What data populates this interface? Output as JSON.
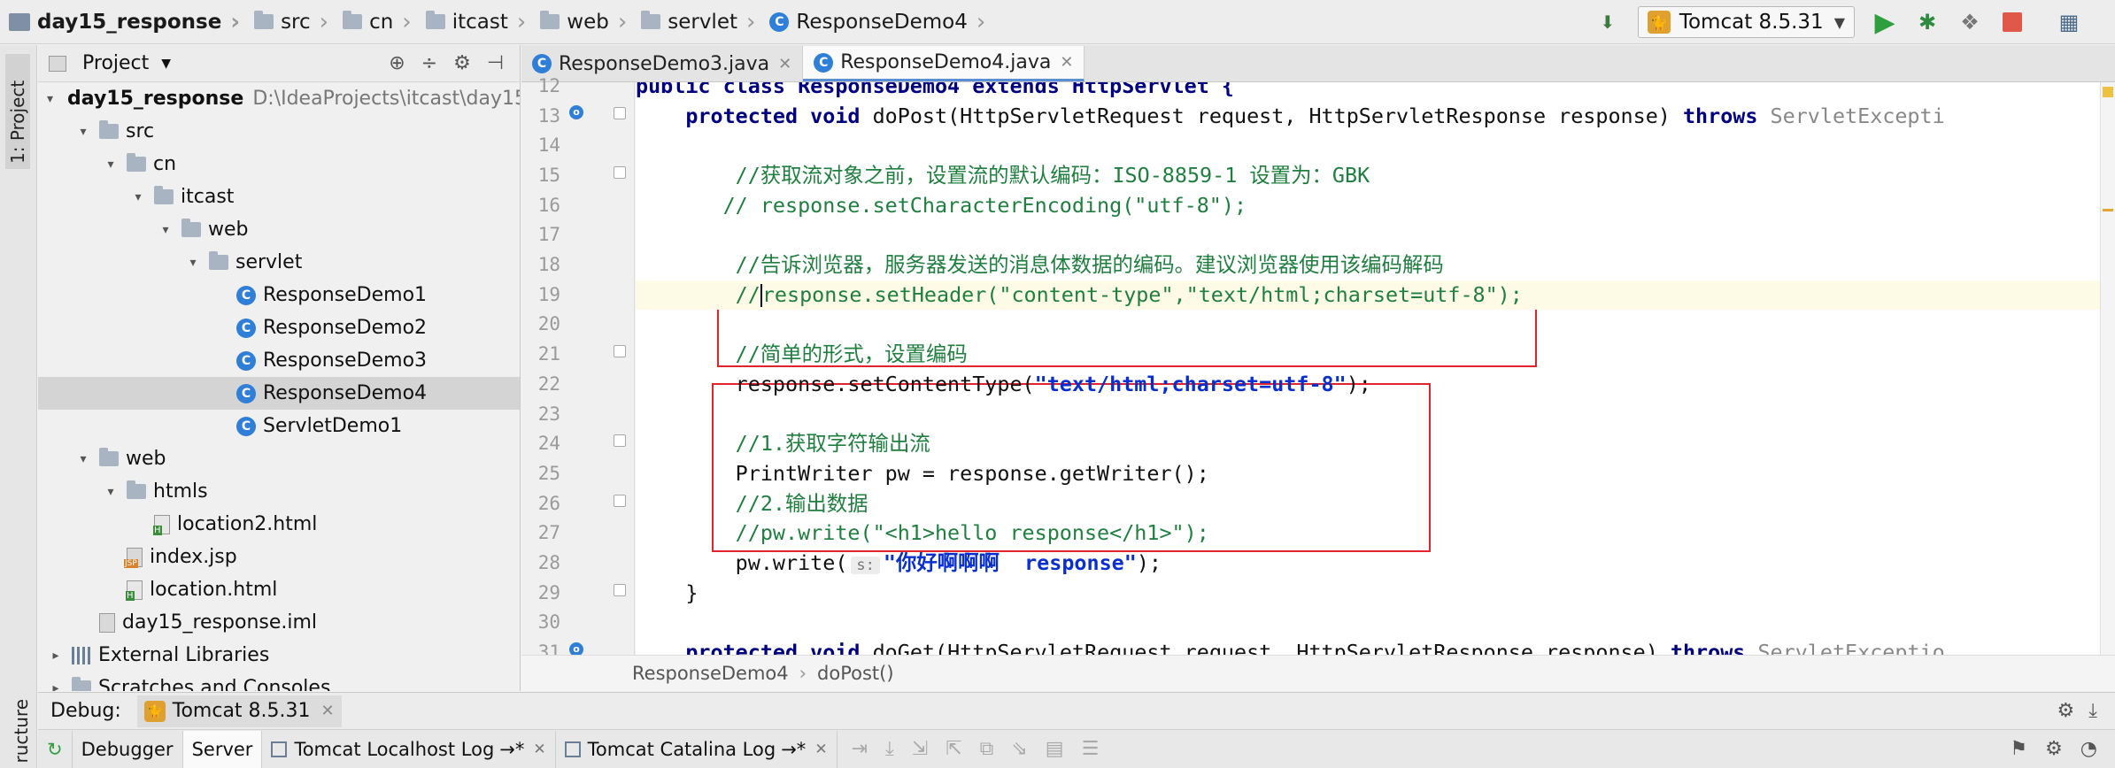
{
  "breadcrumb": [
    {
      "label": "day15_response",
      "icon": "project-module-icon"
    },
    {
      "label": "src",
      "icon": "folder-icon"
    },
    {
      "label": "cn",
      "icon": "folder-icon"
    },
    {
      "label": "itcast",
      "icon": "folder-icon"
    },
    {
      "label": "web",
      "icon": "folder-icon"
    },
    {
      "label": "servlet",
      "icon": "folder-icon"
    },
    {
      "label": "ResponseDemo4",
      "icon": "java-class-icon"
    }
  ],
  "toolbar": {
    "run_config": "Tomcat 8.5.31",
    "accent_run": "#2e9e3e",
    "accent_stop": "#e0584a"
  },
  "side_strip": {
    "project_tab": "1: Project",
    "structure_tab": "ructure"
  },
  "project_panel": {
    "title": "Project",
    "tree": [
      {
        "label": "day15_response",
        "path": "D:\\IdeaProjects\\itcast\\day15",
        "depth": 0,
        "arrow": "▾",
        "icon": "module",
        "bold": true
      },
      {
        "label": "src",
        "depth": 1,
        "arrow": "▾",
        "icon": "folder"
      },
      {
        "label": "cn",
        "depth": 2,
        "arrow": "▾",
        "icon": "folder"
      },
      {
        "label": "itcast",
        "depth": 3,
        "arrow": "▾",
        "icon": "folder"
      },
      {
        "label": "web",
        "depth": 4,
        "arrow": "▾",
        "icon": "folder"
      },
      {
        "label": "servlet",
        "depth": 5,
        "arrow": "▾",
        "icon": "folder"
      },
      {
        "label": "ResponseDemo1",
        "depth": 6,
        "icon": "class"
      },
      {
        "label": "ResponseDemo2",
        "depth": 6,
        "icon": "class"
      },
      {
        "label": "ResponseDemo3",
        "depth": 6,
        "icon": "class"
      },
      {
        "label": "ResponseDemo4",
        "depth": 6,
        "icon": "class",
        "selected": true
      },
      {
        "label": "ServletDemo1",
        "depth": 6,
        "icon": "class"
      },
      {
        "label": "web",
        "depth": 1,
        "arrow": "▾",
        "icon": "folder"
      },
      {
        "label": "htmls",
        "depth": 2,
        "arrow": "▾",
        "icon": "folder"
      },
      {
        "label": "location2.html",
        "depth": 3,
        "icon": "html"
      },
      {
        "label": "index.jsp",
        "depth": 2,
        "icon": "jsp"
      },
      {
        "label": "location.html",
        "depth": 2,
        "icon": "html"
      },
      {
        "label": "day15_response.iml",
        "depth": 1,
        "icon": "file"
      },
      {
        "label": "External Libraries",
        "depth": 0,
        "arrow": "▸",
        "icon": "library"
      },
      {
        "label": "Scratches and Consoles",
        "depth": 0,
        "arrow": "▸",
        "icon": "folder"
      }
    ]
  },
  "editor": {
    "tabs": [
      {
        "label": "ResponseDemo3.java",
        "active": false
      },
      {
        "label": "ResponseDemo4.java",
        "active": true
      }
    ],
    "lines": [
      {
        "n": "12",
        "segments": [
          {
            "t": "public class ResponseDemo4 extends HttpServlet {",
            "c": "kw"
          }
        ]
      },
      {
        "n": "13",
        "segments": [
          {
            "t": "    "
          },
          {
            "t": "protected void ",
            "c": "kw"
          },
          {
            "t": "doPost(HttpServletRequest request, HttpServletResponse response) "
          },
          {
            "t": "throws ",
            "c": "kw"
          },
          {
            "t": "ServletExcepti",
            "c": "gray"
          }
        ]
      },
      {
        "n": "14",
        "segments": []
      },
      {
        "n": "15",
        "segments": [
          {
            "t": "        //获取流对象之前，设置流的默认编码：ISO-8859-1 设置为：GBK",
            "c": "cm"
          }
        ]
      },
      {
        "n": "16",
        "segments": [
          {
            "t": "       // response.setCharacterEncoding(\"utf-8\");",
            "c": "cm"
          }
        ]
      },
      {
        "n": "17",
        "segments": []
      },
      {
        "n": "18",
        "segments": [
          {
            "t": "        //告诉浏览器，服务器发送的消息体数据的编码。建议浏览器使用该编码解码",
            "c": "cm"
          }
        ]
      },
      {
        "n": "19",
        "segments": [
          {
            "t": "        //",
            "c": "cm"
          },
          {
            "t": "|",
            "c": "caret"
          },
          {
            "t": "response.setHeader(\"content-type\",\"text/html;charset=utf-8\");",
            "c": "cm"
          }
        ],
        "current": true
      },
      {
        "n": "20",
        "segments": []
      },
      {
        "n": "21",
        "segments": [
          {
            "t": "        //简单的形式，设置编码",
            "c": "cm"
          }
        ]
      },
      {
        "n": "22",
        "segments": [
          {
            "t": "        response.setContentType("
          },
          {
            "t": "\"text/html;charset=utf-8\"",
            "c": "strb"
          },
          {
            "t": ");"
          }
        ]
      },
      {
        "n": "23",
        "segments": []
      },
      {
        "n": "24",
        "segments": [
          {
            "t": "        //1.获取字符输出流",
            "c": "cm"
          }
        ]
      },
      {
        "n": "25",
        "segments": [
          {
            "t": "        PrintWriter pw = response.getWriter();"
          }
        ]
      },
      {
        "n": "26",
        "segments": [
          {
            "t": "        //2.输出数据",
            "c": "cm"
          }
        ]
      },
      {
        "n": "27",
        "segments": [
          {
            "t": "        //pw.write(\"<h1>hello response</h1>\");",
            "c": "cm"
          }
        ]
      },
      {
        "n": "28",
        "segments": [
          {
            "t": "        pw.write("
          },
          {
            "t": "s:",
            "c": "hint"
          },
          {
            "t": "\"你好啊啊啊  response\"",
            "c": "strb"
          },
          {
            "t": ");"
          }
        ]
      },
      {
        "n": "29",
        "segments": [
          {
            "t": "    }"
          }
        ]
      },
      {
        "n": "30",
        "segments": []
      },
      {
        "n": "31",
        "segments": [
          {
            "t": "    "
          },
          {
            "t": "protected void ",
            "c": "kw"
          },
          {
            "t": "doGet(HttpServletRequest request, HttpServletResponse response) "
          },
          {
            "t": "throws ",
            "c": "kw"
          },
          {
            "t": "ServletExceptio",
            "c": "gray"
          }
        ]
      }
    ],
    "footer_breadcrumb": [
      "ResponseDemo4",
      "doPost()"
    ]
  },
  "debug": {
    "label": "Debug:",
    "session_tab": "Tomcat 8.5.31",
    "tabs": [
      {
        "label": "Debugger",
        "active": false
      },
      {
        "label": "Server",
        "active": true
      },
      {
        "label": "Tomcat Localhost Log",
        "suffix": "→*",
        "active": false
      },
      {
        "label": "Tomcat Catalina Log",
        "suffix": "→*",
        "active": false
      }
    ]
  }
}
